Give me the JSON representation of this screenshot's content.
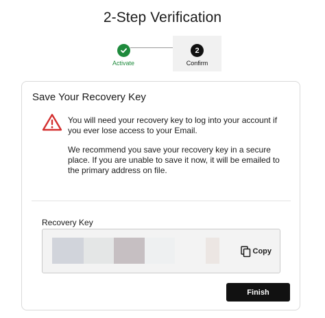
{
  "page": {
    "title": "2-Step Verification"
  },
  "stepper": {
    "steps": [
      {
        "label": "Activate",
        "status": "complete",
        "icon": "check-icon",
        "color": "#1e8a3c"
      },
      {
        "label": "Confirm",
        "number": "2",
        "status": "current",
        "color": "#111111"
      }
    ]
  },
  "card": {
    "title": "Save Your Recovery Key",
    "warning_icon": "warning-triangle-icon",
    "warning_color": "#d32f2f",
    "paragraphs": [
      "You will need your recovery key to log into your account if you ever lose access to your Email.",
      "We recommend you save your recovery key in a secure place. If you are unable to save it now, it will be emailed to the primary address on file."
    ],
    "recovery_key": {
      "label": "Recovery Key",
      "copy_label": "Copy",
      "copy_icon": "copy-icon"
    },
    "finish_label": "Finish"
  }
}
